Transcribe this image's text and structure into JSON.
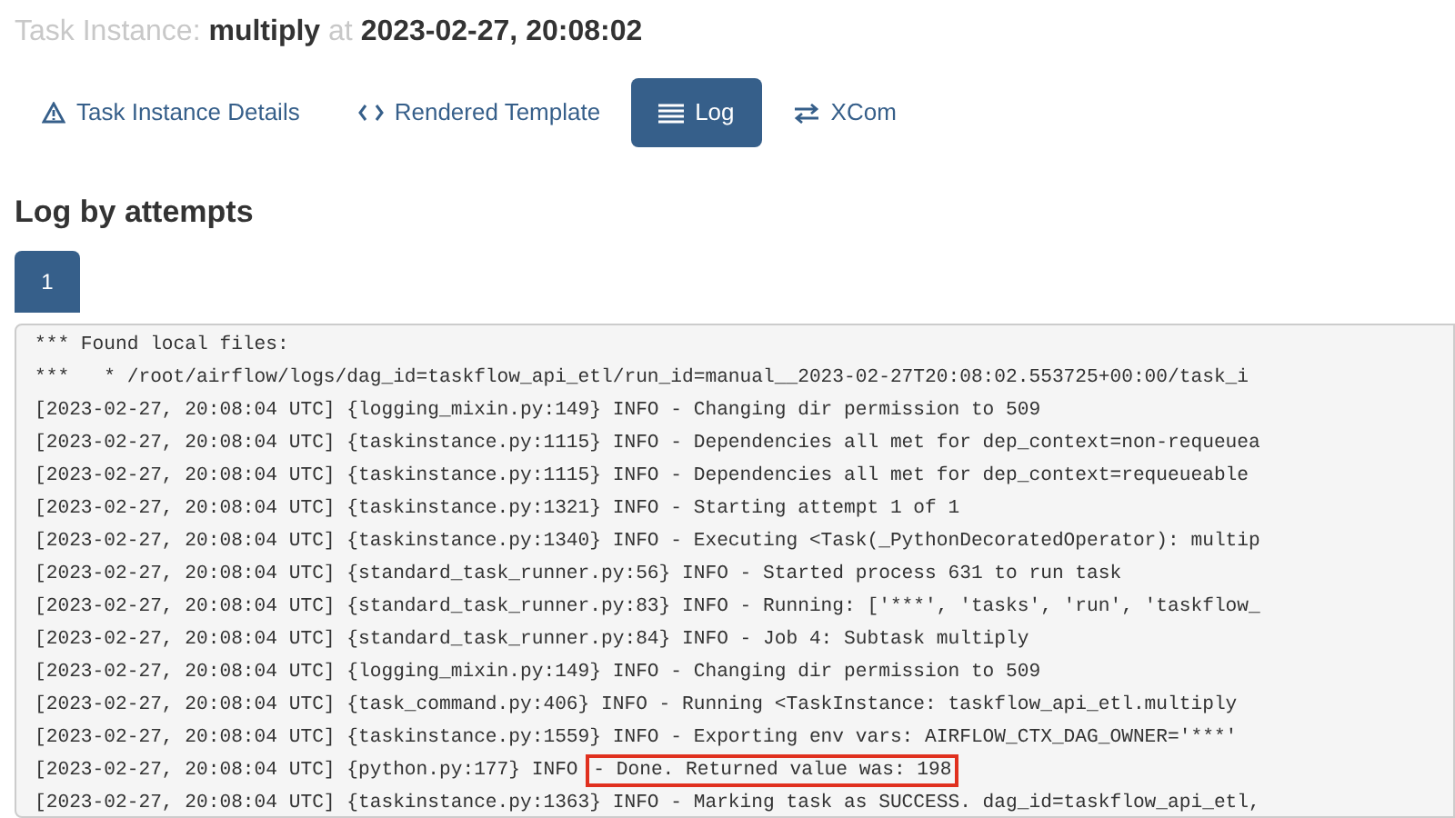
{
  "title": {
    "label": "Task Instance:",
    "task": "multiply",
    "at": "at",
    "date": "2023-02-27, 20:08:02"
  },
  "tabs": [
    {
      "label": "Task Instance Details",
      "kind": "warning",
      "selected": false
    },
    {
      "label": "Rendered Template",
      "kind": "code",
      "selected": false
    },
    {
      "label": "Log",
      "kind": "list",
      "selected": true
    },
    {
      "label": "XCom",
      "kind": "swap",
      "selected": false
    }
  ],
  "heading": "Log by attempts",
  "attempts": [
    {
      "label": "1",
      "selected": true
    }
  ],
  "log_lines": [
    {
      "text": "*** Found local files:"
    },
    {
      "text": "***   * /root/airflow/logs/dag_id=taskflow_api_etl/run_id=manual__2023-02-27T20:08:02.553725+00:00/task_i"
    },
    {
      "text": "[2023-02-27, 20:08:04 UTC] {logging_mixin.py:149} INFO - Changing dir permission to 509"
    },
    {
      "text": "[2023-02-27, 20:08:04 UTC] {taskinstance.py:1115} INFO - Dependencies all met for dep_context=non-requeuea"
    },
    {
      "text": "[2023-02-27, 20:08:04 UTC] {taskinstance.py:1115} INFO - Dependencies all met for dep_context=requeueable"
    },
    {
      "text": "[2023-02-27, 20:08:04 UTC] {taskinstance.py:1321} INFO - Starting attempt 1 of 1"
    },
    {
      "text": "[2023-02-27, 20:08:04 UTC] {taskinstance.py:1340} INFO - Executing <Task(_PythonDecoratedOperator): multip"
    },
    {
      "text": "[2023-02-27, 20:08:04 UTC] {standard_task_runner.py:56} INFO - Started process 631 to run task"
    },
    {
      "text": "[2023-02-27, 20:08:04 UTC] {standard_task_runner.py:83} INFO - Running: ['***', 'tasks', 'run', 'taskflow_"
    },
    {
      "text": "[2023-02-27, 20:08:04 UTC] {standard_task_runner.py:84} INFO - Job 4: Subtask multiply"
    },
    {
      "text": "[2023-02-27, 20:08:04 UTC] {logging_mixin.py:149} INFO - Changing dir permission to 509"
    },
    {
      "text": "[2023-02-27, 20:08:04 UTC] {task_command.py:406} INFO - Running <TaskInstance: taskflow_api_etl.multiply"
    },
    {
      "text": "[2023-02-27, 20:08:04 UTC] {taskinstance.py:1559} INFO - Exporting env vars: AIRFLOW_CTX_DAG_OWNER='***'"
    },
    {
      "text": "[2023-02-27, 20:08:04 UTC] {python.py:177} INFO ",
      "highlighted_text": "- Done. Returned value was: 198"
    },
    {
      "text": "[2023-02-27, 20:08:04 UTC] {taskinstance.py:1363} INFO - Marking task as SUCCESS. dag_id=taskflow_api_etl,"
    }
  ]
}
